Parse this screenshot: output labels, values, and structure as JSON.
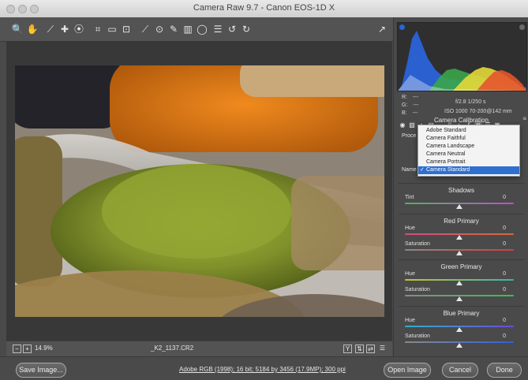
{
  "window": {
    "title": "Camera Raw 9.7  -  Canon EOS-1D X"
  },
  "toolbar": {
    "tools": [
      {
        "name": "zoom-icon",
        "glyph": "🔍"
      },
      {
        "name": "hand-icon",
        "glyph": "✋"
      },
      {
        "name": "eyedropper-icon",
        "glyph": "⟋"
      },
      {
        "name": "color-sampler-icon",
        "glyph": "✚"
      },
      {
        "name": "targeted-adjust-icon",
        "glyph": "⦿"
      },
      {
        "name": "crop-icon",
        "glyph": "⌗"
      },
      {
        "name": "straighten-icon",
        "glyph": "▭"
      },
      {
        "name": "transform-icon",
        "glyph": "⊡"
      },
      {
        "name": "spot-removal-icon",
        "glyph": "⟋"
      },
      {
        "name": "red-eye-icon",
        "glyph": "⊙"
      },
      {
        "name": "brush-icon",
        "glyph": "✎"
      },
      {
        "name": "graduated-filter-icon",
        "glyph": "▥"
      },
      {
        "name": "radial-filter-icon",
        "glyph": "◯"
      },
      {
        "name": "preferences-icon",
        "glyph": "☰"
      },
      {
        "name": "rotate-left-icon",
        "glyph": "↺"
      },
      {
        "name": "rotate-right-icon",
        "glyph": "↻"
      }
    ],
    "right_icon": "↗"
  },
  "status": {
    "zoom": "14.9%",
    "filename": "_K2_1137.CR2"
  },
  "bottom": {
    "save_label": "Save Image...",
    "workflow_link": "Adobe RGB (1998); 16 bit; 5184 by 3456 (17.9MP); 300 ppi",
    "open_label": "Open Image",
    "cancel_label": "Cancel",
    "done_label": "Done"
  },
  "readouts": {
    "r_label": "R:",
    "g_label": "G:",
    "b_label": "B:",
    "r_val": "---",
    "g_val": "---",
    "b_val": "---",
    "aperture_shutter": "f/2.8   1/250 s",
    "iso_lens": "ISO 1000   70-200@142 mm"
  },
  "panel": {
    "section_title": "Camera Calibration",
    "process_label": "Proce",
    "name_label": "Name",
    "shadows_title": "Shadows",
    "tint_label": "Tint",
    "tint_val": "0",
    "red_primary_title": "Red Primary",
    "red_hue_label": "Hue",
    "red_hue_val": "0",
    "red_sat_label": "Saturation",
    "red_sat_val": "0",
    "green_primary_title": "Green Primary",
    "green_hue_label": "Hue",
    "green_hue_val": "0",
    "green_sat_label": "Saturation",
    "green_sat_val": "0",
    "blue_primary_title": "Blue Primary",
    "blue_hue_label": "Hue",
    "blue_hue_val": "0",
    "blue_sat_label": "Saturation",
    "blue_sat_val": "0"
  },
  "dropdown": {
    "items": [
      "Adobe Standard",
      "Camera Faithful",
      "Camera Landscape",
      "Camera Neutral",
      "Camera Portrait",
      "Camera Standard"
    ],
    "selected_check": "✓"
  },
  "colors": {
    "selection_blue": "#2f6fd0",
    "panel_bg": "#4a4a4a"
  }
}
